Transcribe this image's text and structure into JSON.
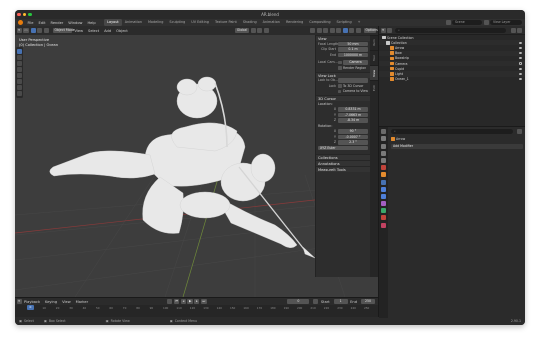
{
  "window": {
    "title": "AR.blend"
  },
  "menu": [
    "File",
    "Edit",
    "Render",
    "Window",
    "Help"
  ],
  "workspaces": [
    {
      "label": "Layout",
      "active": true
    },
    {
      "label": "Animation"
    },
    {
      "label": "Modeling"
    },
    {
      "label": "Sculpting"
    },
    {
      "label": "UV Editing"
    },
    {
      "label": "Texture Paint"
    },
    {
      "label": "Shading"
    },
    {
      "label": "Animation"
    },
    {
      "label": "Rendering"
    },
    {
      "label": "Compositing"
    },
    {
      "label": "Scripting"
    }
  ],
  "topright": {
    "scene": "Scene",
    "view_layer": "View Layer"
  },
  "viewport_header": {
    "mode": "Object Mode",
    "view": "View",
    "select": "Select",
    "add": "Add",
    "object": "Object",
    "orientation": "Global",
    "options": "Options"
  },
  "viewport": {
    "line1": "User Perspective",
    "line2": "(0) Collection | Ocean"
  },
  "npanel": {
    "tabs": [
      "Item",
      "Tool",
      "View",
      "Edit"
    ],
    "active_tab": "View",
    "view_header": "View",
    "focal_length_label": "Focal Length",
    "focal_length": "50 mm",
    "clip_start_label": "Clip Start",
    "clip_start": "0.1 m",
    "clip_end_label": "End",
    "clip_end": "1000000 m",
    "local_camera_label": "Local Cam...",
    "local_camera": "Camera",
    "render_region": "Render Region",
    "view_lock_header": "View Lock",
    "lock_to_object_label": "Lock to Ob...",
    "lock_label": "Lock",
    "to_3d_cursor": "To 3D Cursor",
    "camera_to_view": "Camera to View",
    "cursor_header": "3D Cursor",
    "location_label": "Location:",
    "loc_x": "0.8331 m",
    "loc_y": "-7.0663 m",
    "loc_z": "-8.34 m",
    "rotation_label": "Rotation:",
    "rot_x": "90 °",
    "rot_y": "-0.0007 °",
    "rot_z": "2.3 °",
    "rotation_mode": "XYZ Euler",
    "collections": "Collections",
    "annotations": "Annotations",
    "measureit": "MeasureIt Tools"
  },
  "timeline": {
    "playback": "Playback",
    "keying": "Keying",
    "view": "View",
    "marker": "Marker",
    "current_frame": "0",
    "start_label": "Start",
    "start": "1",
    "end_label": "End",
    "end": "250",
    "ticks": [
      "0",
      "10",
      "20",
      "30",
      "40",
      "50",
      "60",
      "70",
      "80",
      "90",
      "100",
      "110",
      "120",
      "130",
      "140",
      "150",
      "160",
      "170",
      "180",
      "190",
      "200",
      "210",
      "220",
      "230",
      "240",
      "250"
    ]
  },
  "statusbar": {
    "select": "Select",
    "box_select": "Box Select",
    "rotate_view": "Rotate View",
    "context_menu": "Context Menu",
    "version": "2.90.1"
  },
  "outliner": {
    "root": "Scene Collection",
    "items": [
      {
        "label": "Collection",
        "indent": 1,
        "color": "#c9c9c9"
      },
      {
        "label": "Arrow",
        "indent": 2,
        "color": "#e38b2e"
      },
      {
        "label": "Bow",
        "indent": 2,
        "color": "#e38b2e"
      },
      {
        "label": "Bowstrip",
        "indent": 2,
        "color": "#e38b2e"
      },
      {
        "label": "Camera",
        "indent": 2,
        "color": "#e38b2e"
      },
      {
        "label": "Cupid",
        "indent": 2,
        "color": "#e38b2e"
      },
      {
        "label": "Light",
        "indent": 2,
        "color": "#e38b2e"
      },
      {
        "label": "Ocean_1",
        "indent": 2,
        "color": "#e38b2e"
      }
    ]
  },
  "properties": {
    "object_name": "Arrow",
    "section": "Add Modifier"
  },
  "colors": {
    "accent": "#4772b3",
    "orange": "#e87d0d",
    "sculpt": "#e6e6e6"
  }
}
